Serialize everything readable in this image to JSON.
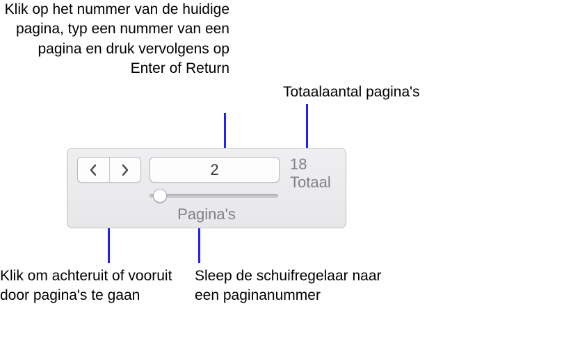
{
  "callouts": {
    "page_field": "Klik op het nummer van de huidige pagina, typ een nummer van een pagina en druk vervolgens op Enter of Return",
    "total": "Totaalaantal pagina's",
    "nav": "Klik om achteruit of vooruit door pagina's te gaan",
    "slider": "Sleep de schuifregelaar naar een paginanummer"
  },
  "panel": {
    "current_page": "2",
    "total_pages": "18",
    "total_label": "Totaal",
    "caption": "Pagina's"
  }
}
